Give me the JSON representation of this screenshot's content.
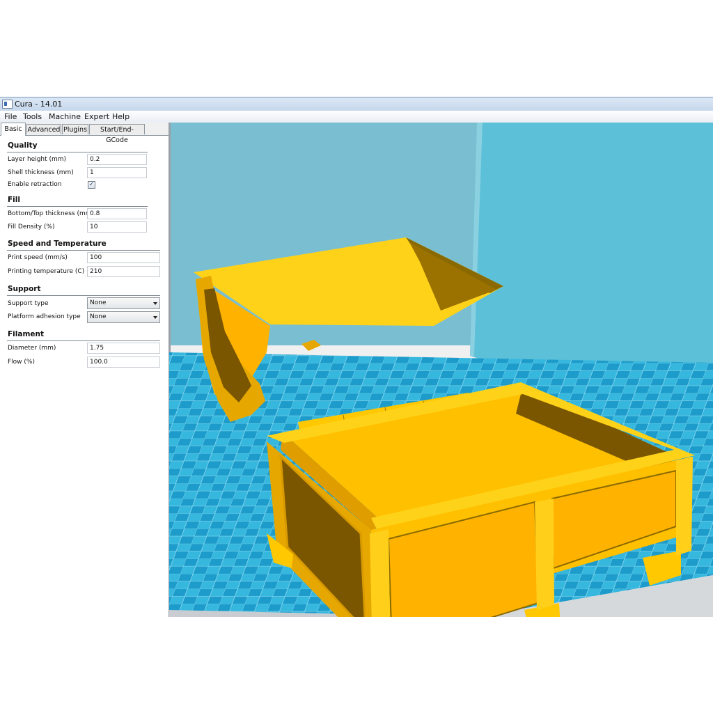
{
  "window": {
    "title": "Cura - 14.01",
    "menu": [
      "File",
      "Tools",
      "Machine",
      "Expert",
      "Help"
    ]
  },
  "tabs": [
    "Basic",
    "Advanced",
    "Plugins",
    "Start/End-GCode"
  ],
  "active_tab": "Basic",
  "quality": {
    "title": "Quality",
    "layer_height_label": "Layer height (mm)",
    "layer_height": "0.2",
    "shell_thickness_label": "Shell thickness (mm)",
    "shell_thickness": "1",
    "retraction_label": "Enable retraction",
    "retraction_checked": true
  },
  "fill": {
    "title": "Fill",
    "bottom_top_label": "Bottom/Top thickness (mm)",
    "bottom_top": "0.8",
    "density_label": "Fill Density (%)",
    "density": "10"
  },
  "speed": {
    "title": "Speed and Temperature",
    "print_speed_label": "Print speed (mm/s)",
    "print_speed": "100",
    "temperature_label": "Printing temperature (C)",
    "temperature": "210"
  },
  "support": {
    "title": "Support",
    "type_label": "Support type",
    "type_value": "None",
    "adhesion_label": "Platform adhesion type",
    "adhesion_value": "None"
  },
  "filament": {
    "title": "Filament",
    "diameter_label": "Diameter (mm)",
    "diameter": "1.75",
    "flow_label": "Flow (%)",
    "flow": "100.0"
  },
  "colors": {
    "model": "#ffc800",
    "model_shadow": "#7a5600",
    "build_plate_light": "#35b7de",
    "build_plate_dark": "#1d9ccb",
    "wall_back": "#79bfd1",
    "wall_right": "#5cc0d8"
  }
}
